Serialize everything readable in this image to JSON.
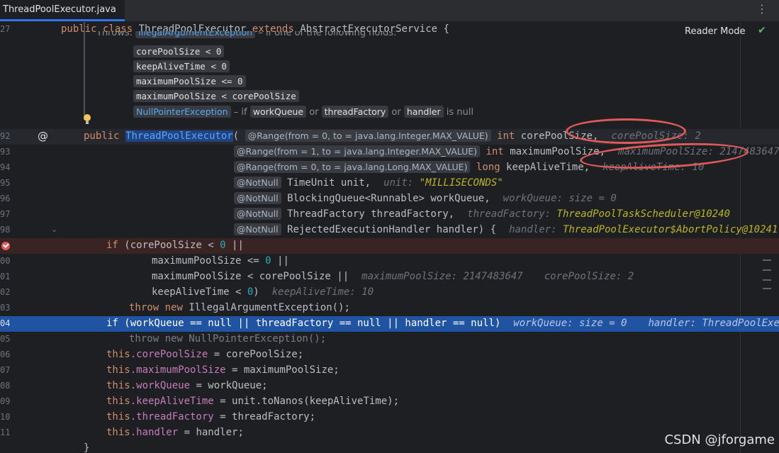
{
  "tab": {
    "title": "ThreadPoolExecutor.java"
  },
  "editor": {
    "reader_mode": "Reader Mode",
    "watermark": "CSDN @jforgame",
    "class_line": {
      "number": "27",
      "public": "public",
      "class": "class",
      "name": "ThreadPoolExecutor",
      "extends": "extends",
      "parent": "AbstractExecutorService",
      "brace": "{"
    },
    "doc": {
      "throws_label": "Throws:",
      "throws_link": "IllegalArgumentException",
      "throws_text": "– if one of the following holds:",
      "conditions": [
        "corePoolSize < 0",
        "keepAliveTime < 0",
        "maximumPoolSize <= 0",
        "maximumPoolSize < corePoolSize"
      ],
      "npe_link": "NullPointerException",
      "npe_if": "– if",
      "npe_a": "workQueue",
      "or1": "or",
      "npe_b": "threadFactory",
      "or2": "or",
      "npe_c": "handler",
      "is_null": "is null"
    },
    "lines": {
      "l92": {
        "number": "92",
        "public": "public",
        "name": "ThreadPoolExecutor",
        "paren": "(",
        "ann": "@Range(from = 0, to = java.lang.Integer.MAX_VALUE)",
        "type": "int",
        "param": "corePoolSize,",
        "hint_name": "corePoolSize:",
        "hint_val": "2"
      },
      "l93": {
        "number": "93",
        "ann": "@Range(from = 1, to = java.lang.Integer.MAX_VALUE)",
        "type": "int",
        "param": "maximumPoolSize,",
        "hint_name": "maximumPoolSize:",
        "hint_val": "2147483647"
      },
      "l94": {
        "number": "94",
        "ann": "@Range(from = 0, to = java.lang.Long.MAX_VALUE)",
        "type": "long",
        "param": "keepAliveTime,",
        "hint_name": "keepAliveTime:",
        "hint_val": "10"
      },
      "l95": {
        "number": "95",
        "ann": "@NotNull",
        "param": "TimeUnit unit,",
        "hint_name": "unit:",
        "hint_val": "\"MILLISECONDS\""
      },
      "l96": {
        "number": "96",
        "ann": "@NotNull",
        "param": "BlockingQueue<Runnable> workQueue,",
        "hint_name": "workQueue:",
        "hint_val": "size = 0"
      },
      "l97": {
        "number": "97",
        "ann": "@NotNull",
        "param": "ThreadFactory threadFactory,",
        "hint_name": "threadFactory:",
        "hint_val": "ThreadPoolTaskScheduler@10240"
      },
      "l98": {
        "number": "98",
        "ann": "@NotNull",
        "param": "RejectedExecutionHandler handler) {",
        "hint_name": "handler:",
        "hint_val": "ThreadPoolExecutor$AbortPolicy@10241"
      },
      "l99": {
        "if": "if",
        "pre": " (corePoolSize < ",
        "num": "0",
        "post": " ||"
      },
      "l100": {
        "number": "00",
        "pre": "maximumPoolSize <= ",
        "num": "0",
        "post": " ||"
      },
      "l101": {
        "number": "01",
        "code": "maximumPoolSize < corePoolSize ||",
        "hint1_name": "maximumPoolSize:",
        "hint1_val": "2147483647",
        "hint2_name": "corePoolSize:",
        "hint2_val": "2"
      },
      "l102": {
        "number": "02",
        "pre": "keepAliveTime < ",
        "num": "0",
        "post": ")",
        "hint_name": "keepAliveTime:",
        "hint_val": "10"
      },
      "l103": {
        "number": "03",
        "throw": "throw",
        "new": "new",
        "code": "IllegalArgumentException();"
      },
      "l104": {
        "number": "04",
        "code": "if (workQueue == null || threadFactory == null || handler == null)",
        "hint1_name": "workQueue:",
        "hint1_val": "size = 0",
        "hint2_name": "handler:",
        "hint2_val": "ThreadPoolExecut"
      },
      "l105": {
        "number": "05",
        "code": "throw new NullPointerException();"
      },
      "l106": {
        "number": "06",
        "this": "this",
        "field": ".corePoolSize",
        "rest": " = corePoolSize;"
      },
      "l107": {
        "number": "07",
        "this": "this",
        "field": ".maximumPoolSize",
        "rest": " = maximumPoolSize;"
      },
      "l108": {
        "number": "08",
        "this": "this",
        "field": ".workQueue",
        "rest": " = workQueue;"
      },
      "l109": {
        "number": "09",
        "this": "this",
        "field": ".keepAliveTime",
        "rest": " = unit.toNanos(keepAliveTime);"
      },
      "l110": {
        "number": "10",
        "this": "this",
        "field": ".threadFactory",
        "rest": " = threadFactory;"
      },
      "l111": {
        "number": "11",
        "this": "this",
        "field": ".handler",
        "rest": " = handler;"
      },
      "l112": {
        "code": "}"
      }
    }
  },
  "colors": {
    "annotation_circle": "#e05a5a",
    "selection_line": "#2153a3",
    "breakpoint_line": "#3a2323"
  }
}
